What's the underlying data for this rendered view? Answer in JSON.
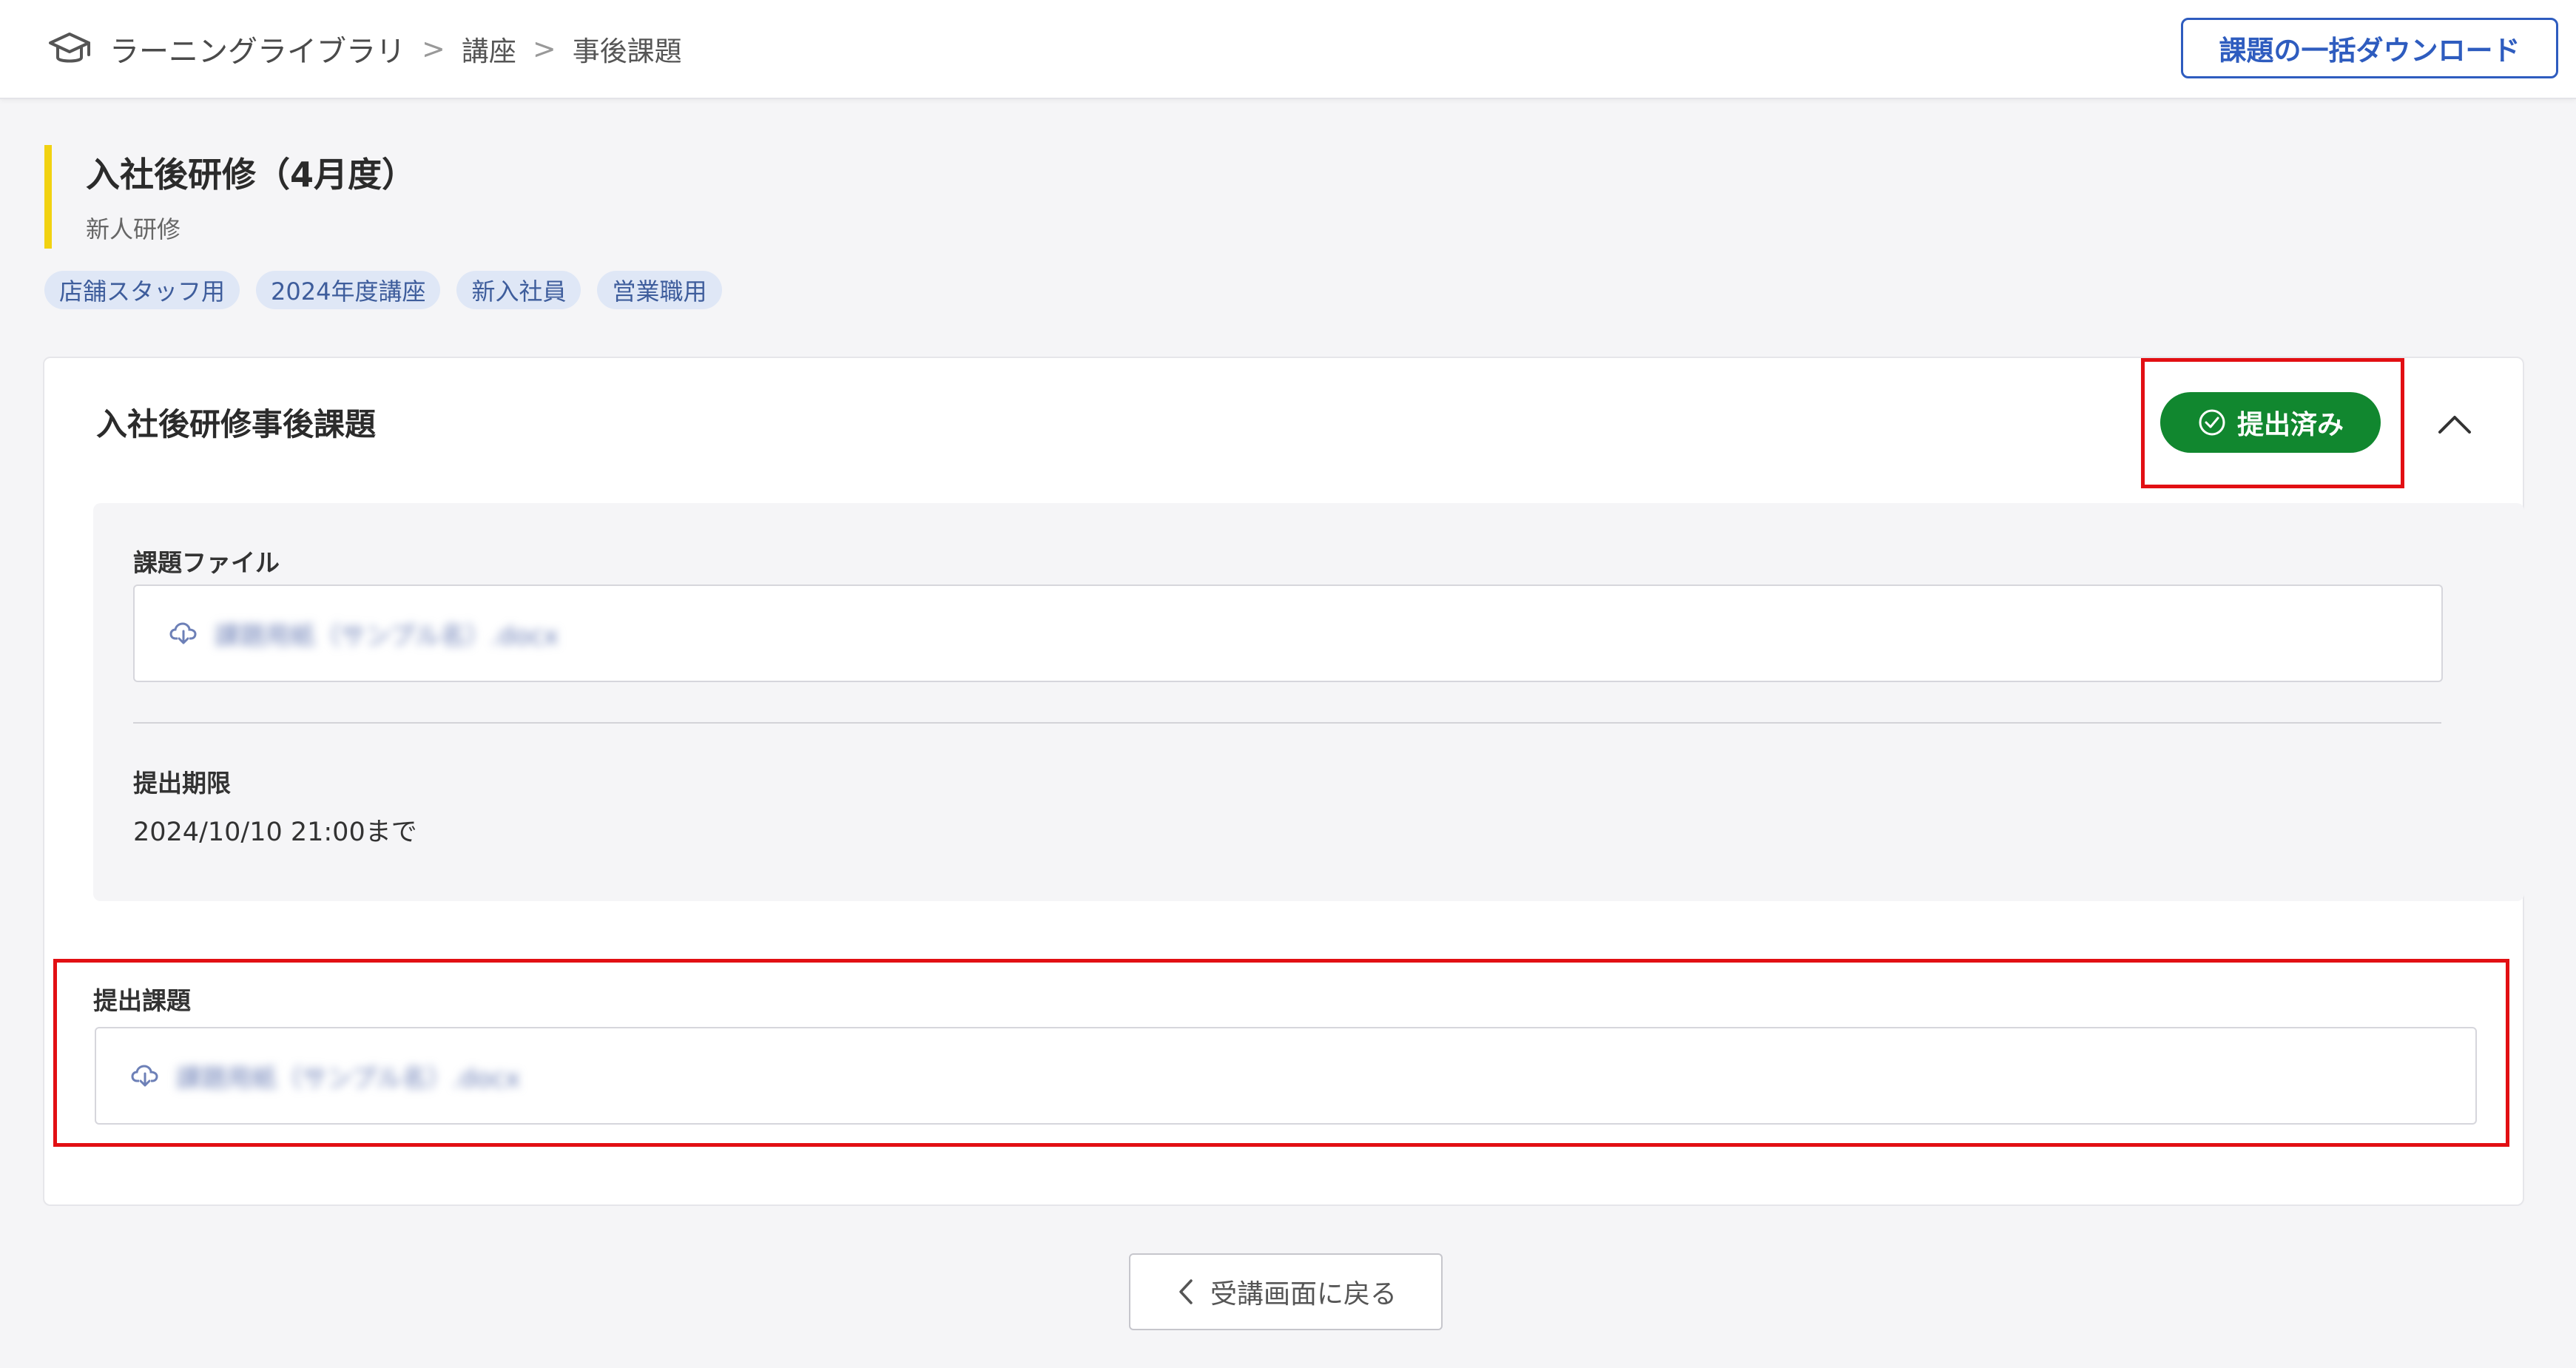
{
  "header": {
    "breadcrumb": [
      {
        "label": "ラーニングライブラリ"
      },
      {
        "label": "講座"
      },
      {
        "label": "事後課題"
      }
    ],
    "separator": ">",
    "bulk_download_label": "課題の一括ダウンロード",
    "logo_icon": "graduation-cap-icon"
  },
  "course": {
    "title": "入社後研修（4月度）",
    "subtitle": "新人研修",
    "tags": [
      "店舗スタッフ用",
      "2024年度講座",
      "新入社員",
      "営業職用"
    ],
    "accent_color": "#f1d211"
  },
  "assignment": {
    "title": "入社後研修事後課題",
    "status": "提出済み",
    "status_color": "#11872f",
    "collapse_icon": "chevron-up-icon",
    "assignment_file": {
      "label": "課題ファイル",
      "file_name": "課題用紙（サンプル名）.docx"
    },
    "deadline": {
      "label": "提出期限",
      "value": "2024/10/10 21:00まで"
    },
    "submission": {
      "label": "提出課題",
      "file_name": "課題用紙（サンプル名）.docx"
    }
  },
  "footer": {
    "back_label": "受講画面に戻る"
  },
  "colors": {
    "highlight": "#e20f13",
    "primary": "#2e5cbf",
    "tag_bg": "#dfe7f6"
  }
}
